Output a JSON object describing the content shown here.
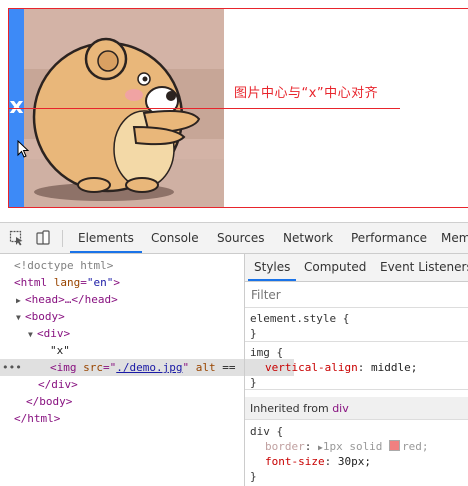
{
  "page": {
    "x_text": "x",
    "annotation": "图片中心与“x”中心对齐"
  },
  "devtools": {
    "tabs": [
      "Elements",
      "Console",
      "Sources",
      "Network",
      "Performance",
      "Mem"
    ],
    "active_tab": "Elements",
    "elements": {
      "doctype": "<!doctype html>",
      "html_open_tag": "<html",
      "html_lang_attr": "lang",
      "html_lang_val": "\"en\"",
      "html_open_close": ">",
      "head_collapsed": "<head>…</head>",
      "body_open": "<body>",
      "div_open": "<div>",
      "text_node": "\"x\"",
      "img_tag": "<img",
      "img_src_attr": "src",
      "img_src_eq": "=\"",
      "img_src_val": "./demo.jpg",
      "img_src_close": "\"",
      "img_alt_attr": "alt",
      "img_tail": " ==",
      "selected_dots": "•••",
      "div_close": "</div>",
      "body_close": "</body>",
      "html_close": "</html>"
    },
    "styles": {
      "tabs": [
        "Styles",
        "Computed",
        "Event Listeners"
      ],
      "active_tab": "Styles",
      "filter_placeholder": "Filter",
      "element_style_selector": "element.style {",
      "close_brace": "}",
      "img_selector": "img {",
      "img_prop": "vertical-align",
      "img_val": "middle;",
      "inherited_label": "Inherited from",
      "inherited_from": "div",
      "div_selector": "div {",
      "border_prop": "border",
      "border_val_pre": "1px solid",
      "border_val_post": "red;",
      "fontsize_prop": "font-size",
      "fontsize_val": "30px;",
      "swatch_color": "#f08080"
    }
  },
  "colors": {
    "border_red": "#e8242c",
    "highlight_blue": "#3d8af7",
    "accent_tab": "#1a73e8"
  }
}
